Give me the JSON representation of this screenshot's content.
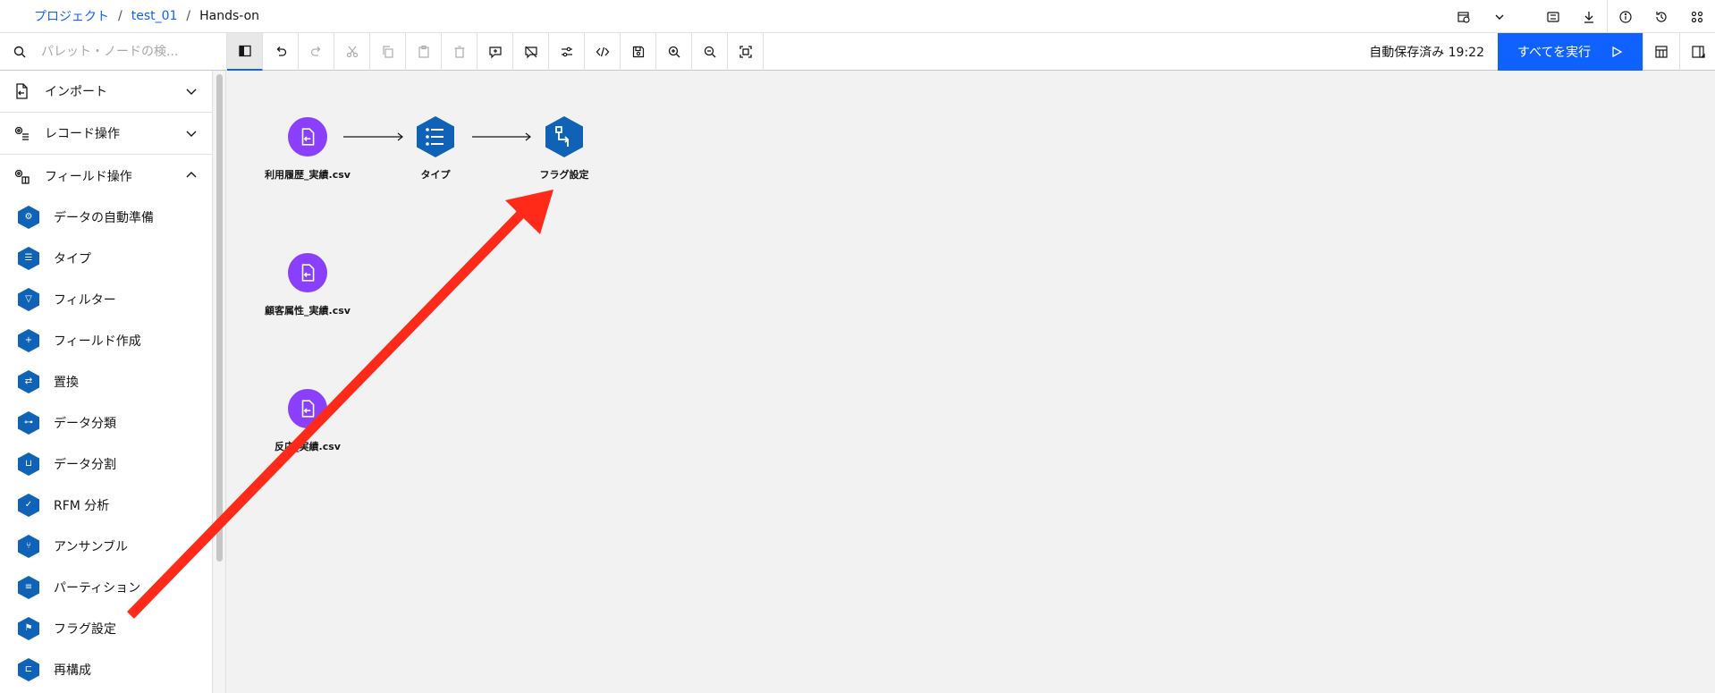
{
  "breadcrumb": {
    "project": "プロジェクト",
    "flow_name": "test_01",
    "current": "Hands-on"
  },
  "toolbar": {
    "search_placeholder": "パレット・ノードの検...",
    "autosave": "自動保存済み 19:22",
    "run_all": "すべてを実行"
  },
  "sidebar": {
    "categories": [
      {
        "label": "インポート",
        "icon": "import-icon",
        "expanded": false
      },
      {
        "label": "レコード操作",
        "icon": "record-ops-icon",
        "expanded": false
      },
      {
        "label": "フィールド操作",
        "icon": "field-ops-icon",
        "expanded": true
      }
    ],
    "items": [
      {
        "label": "データの自動準備",
        "icon": "gear"
      },
      {
        "label": "タイプ",
        "icon": "list"
      },
      {
        "label": "フィルター",
        "icon": "filter"
      },
      {
        "label": "フィールド作成",
        "icon": "derive"
      },
      {
        "label": "置換",
        "icon": "replace"
      },
      {
        "label": "データ分類",
        "icon": "binning"
      },
      {
        "label": "データ分割",
        "icon": "partition-bucket"
      },
      {
        "label": "RFM 分析",
        "icon": "rfm"
      },
      {
        "label": "アンサンブル",
        "icon": "ensemble"
      },
      {
        "label": "パーティション",
        "icon": "partition"
      },
      {
        "label": "フラグ設定",
        "icon": "flag"
      },
      {
        "label": "再構成",
        "icon": "restructure"
      }
    ]
  },
  "canvas": {
    "nodes": [
      {
        "label": "利用履歴_実績.csv",
        "type": "import"
      },
      {
        "label": "タイプ",
        "type": "type"
      },
      {
        "label": "フラグ設定",
        "type": "setflag"
      },
      {
        "label": "顧客属性_実績.csv",
        "type": "import"
      },
      {
        "label": "反応_実績.csv",
        "type": "import"
      }
    ]
  },
  "colors": {
    "accent": "#0f62fe",
    "import_node": "#8a3ffc",
    "op_node": "#0f62b5",
    "annotation_arrow": "#ff2a1a"
  }
}
